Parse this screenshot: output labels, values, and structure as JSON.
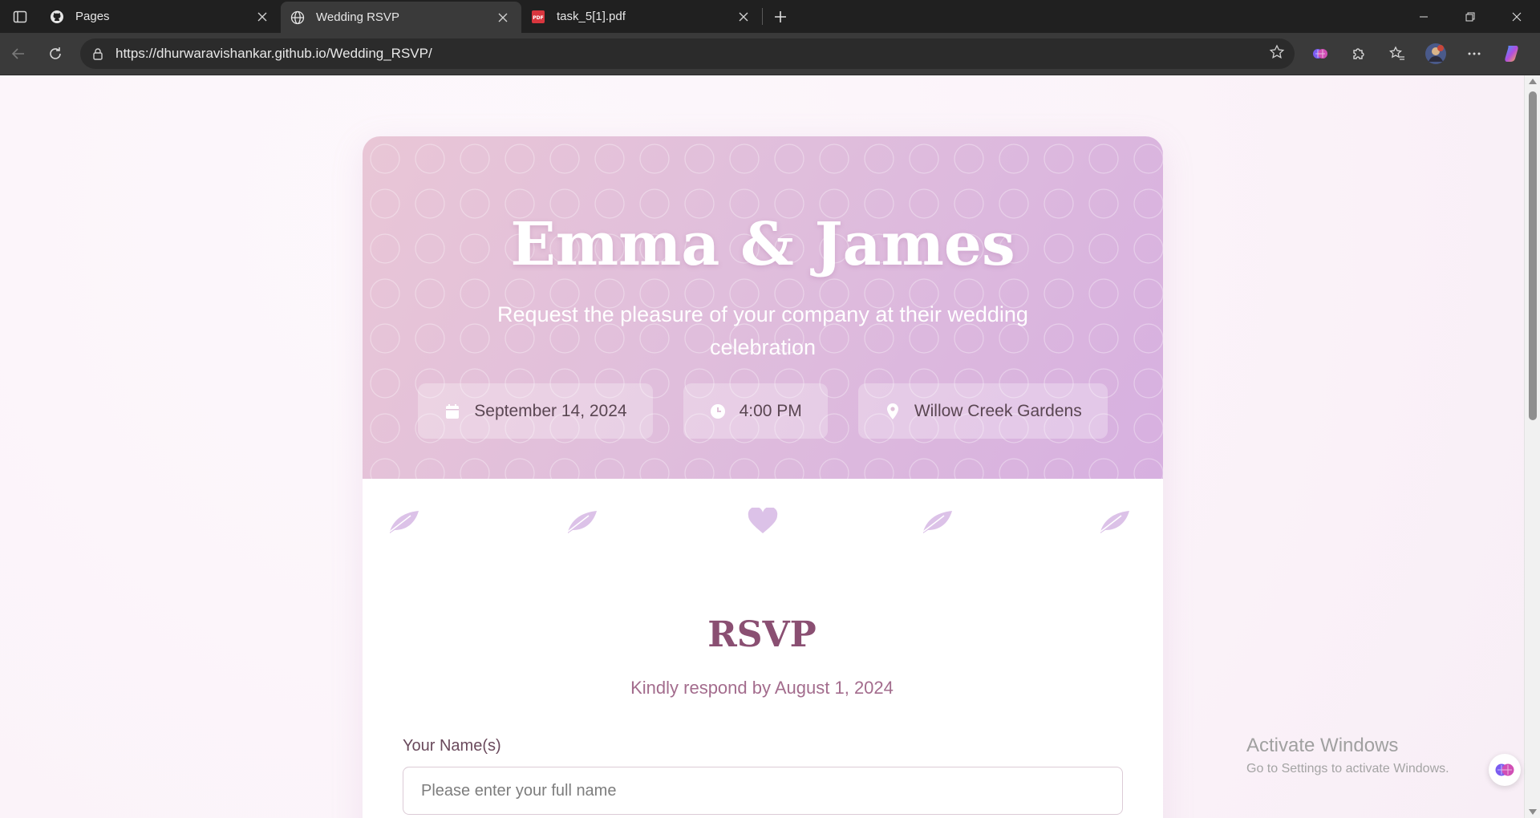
{
  "browser": {
    "tabs": [
      {
        "title": "Pages",
        "icon": "github-icon",
        "active": false
      },
      {
        "title": "Wedding RSVP",
        "icon": "globe-icon",
        "active": true
      },
      {
        "title": "task_5[1].pdf",
        "icon": "pdf-icon",
        "active": false
      }
    ],
    "url": "https://dhurwaravishankar.github.io/Wedding_RSVP/"
  },
  "hero": {
    "title": "Emma & James",
    "subtitle": "Request the pleasure of your company at their wedding celebration",
    "details": [
      {
        "icon": "calendar-icon",
        "text": "September 14, 2024"
      },
      {
        "icon": "clock-icon",
        "text": "4:00 PM"
      },
      {
        "icon": "location-pin-icon",
        "text": "Willow Creek Gardens"
      }
    ]
  },
  "ornaments": [
    "feather-icon",
    "feather-icon",
    "heart-icon",
    "feather-icon",
    "feather-icon"
  ],
  "rsvp": {
    "title": "RSVP",
    "subtitle": "Kindly respond by August 1, 2024",
    "name_label": "Your Name(s)",
    "name_placeholder": "Please enter your full name"
  },
  "watermark": {
    "title": "Activate Windows",
    "subtitle": "Go to Settings to activate Windows."
  },
  "colors": {
    "accent": "#8a4f72",
    "hero_start": "#e9c6d6",
    "hero_end": "#d7b0e0",
    "ornament": "#dcc2e8"
  }
}
